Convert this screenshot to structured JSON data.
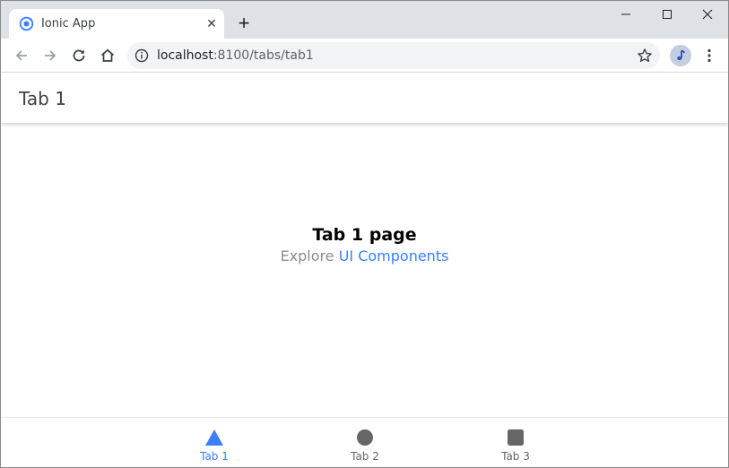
{
  "browser": {
    "tab_title": "Ionic App",
    "tab_close": "✕",
    "new_tab": "+",
    "url_host": "localhost",
    "url_path": ":8100/tabs/tab1"
  },
  "header": {
    "title": "Tab 1"
  },
  "main": {
    "heading": "Tab 1 page",
    "explore_prefix": "Explore ",
    "explore_link": "UI Components"
  },
  "tabbar": {
    "items": [
      {
        "label": "Tab 1",
        "icon": "triangle-icon",
        "selected": true
      },
      {
        "label": "Tab 2",
        "icon": "ellipse-icon",
        "selected": false
      },
      {
        "label": "Tab 3",
        "icon": "square-icon",
        "selected": false
      }
    ]
  },
  "colors": {
    "primary": "#3880ff",
    "tab_inactive": "#666666",
    "tabstrip_bg": "#dee1e6"
  }
}
